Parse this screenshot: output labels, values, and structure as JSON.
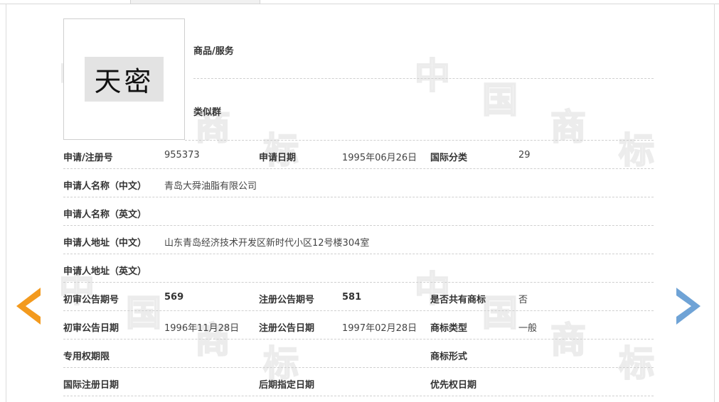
{
  "watermark_char_1": "中",
  "watermark_char_2": "国",
  "watermark_char_3": "商",
  "watermark_char_4": "标",
  "trademark_image_text": "天密",
  "goods_services_label": "商品/服务",
  "similar_group_label": "类似群",
  "rows": [
    [
      {
        "label": "申请/注册号",
        "value": "955373"
      },
      {
        "label": "申请日期",
        "value": "1995年06月26日"
      },
      {
        "label": "国际分类",
        "value": "29"
      }
    ],
    [
      {
        "label": "申请人名称（中文）",
        "value": "青岛大舜油脂有限公司"
      }
    ],
    [
      {
        "label": "申请人名称（英文）",
        "value": ""
      }
    ],
    [
      {
        "label": "申请人地址（中文）",
        "value": "山东青岛经济技术开发区新时代小区12号楼304室"
      }
    ],
    [
      {
        "label": "申请人地址（英文）",
        "value": ""
      }
    ],
    [
      {
        "label": "初审公告期号",
        "value": "569"
      },
      {
        "label": "注册公告期号",
        "value": "581"
      },
      {
        "label": "是否共有商标",
        "value": "否"
      }
    ],
    [
      {
        "label": "初审公告日期",
        "value": "1996年11月28日"
      },
      {
        "label": "注册公告日期",
        "value": "1997年02月28日"
      },
      {
        "label": "商标类型",
        "value": "一般"
      }
    ],
    [
      {
        "label": "专用权期限",
        "value": ""
      },
      {
        "label": "商标形式",
        "value": ""
      }
    ],
    [
      {
        "label": "国际注册日期",
        "value": ""
      },
      {
        "label": "后期指定日期",
        "value": ""
      },
      {
        "label": "优先权日期",
        "value": ""
      }
    ]
  ],
  "colors": {
    "prev_arrow": "#f39a1e",
    "next_arrow": "#6fa3d6",
    "dashed_line": "#cfcfcf"
  }
}
